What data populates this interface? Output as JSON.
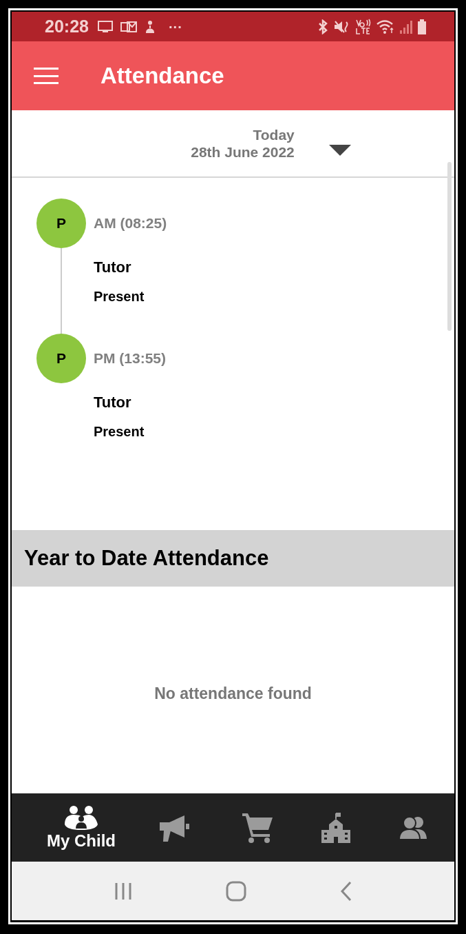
{
  "status_bar": {
    "time": "20:28",
    "dots": "···"
  },
  "app_bar": {
    "title": "Attendance"
  },
  "date_selector": {
    "label": "Today",
    "date": "28th June 2022"
  },
  "sessions": [
    {
      "mark": "P",
      "color": "#8dc63f",
      "session": "AM (08:25)",
      "register": "Tutor",
      "status": "Present"
    },
    {
      "mark": "P",
      "color": "#8dc63f",
      "session": "PM (13:55)",
      "register": "Tutor",
      "status": "Present"
    }
  ],
  "year_to_date": {
    "heading": "Year to Date Attendance",
    "empty_message": "No attendance found"
  },
  "bottom_nav": [
    {
      "kind": "child",
      "label": "My Child",
      "selected": true
    },
    {
      "kind": "announcements",
      "selected": false
    },
    {
      "kind": "shop",
      "selected": false
    },
    {
      "kind": "school",
      "selected": false
    },
    {
      "kind": "contacts",
      "selected": false
    }
  ]
}
